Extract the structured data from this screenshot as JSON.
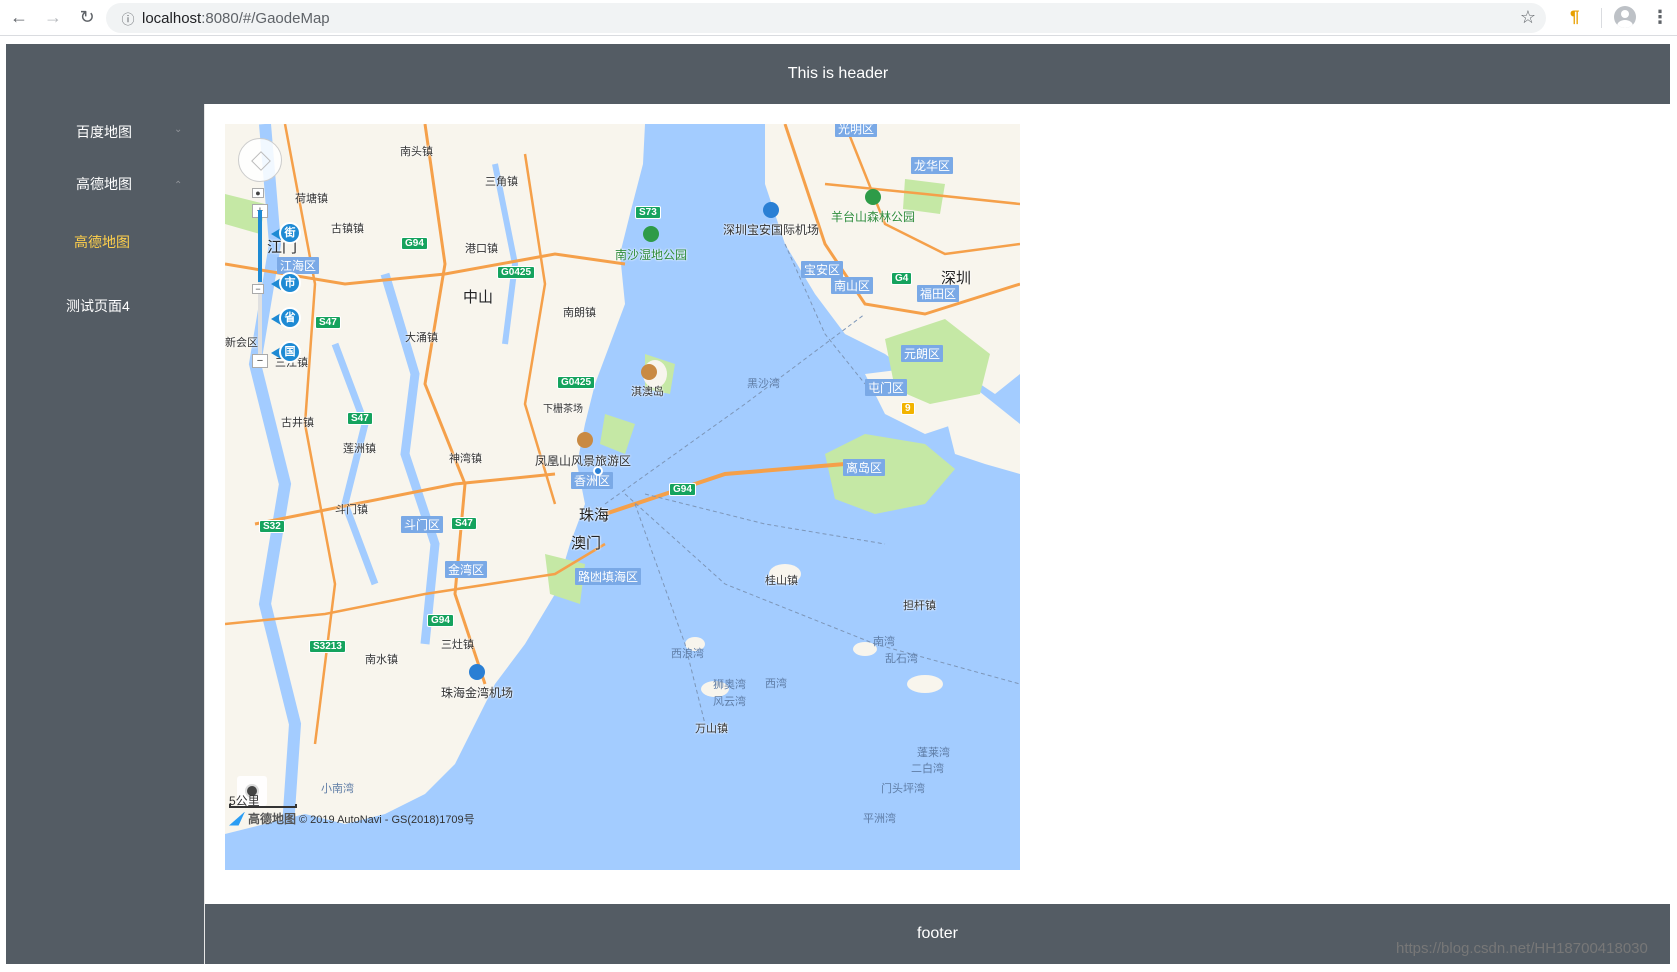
{
  "browser": {
    "back_icon": "arrow-left-icon",
    "forward_icon": "arrow-right-icon",
    "reload_icon": "reload-icon",
    "url_host": "localhost",
    "url_rest": ":8080/#/GaodeMap",
    "bookmark_icon": "star-icon"
  },
  "header": {
    "title": "This is header"
  },
  "sidebar": {
    "menu": [
      {
        "label": "百度地图",
        "expanded": false
      },
      {
        "label": "高德地图",
        "expanded": true
      },
      {
        "label": "测试页面4"
      }
    ],
    "submenu": [
      {
        "label": "高德地图",
        "active": true
      }
    ],
    "active_color": "#ffd04b",
    "bg_color": "#545c64"
  },
  "map": {
    "labels": {
      "zhongshan": "中山",
      "zhuhai": "珠海",
      "macau": "澳门",
      "shenzhen": "深圳",
      "jiangmen": "江门",
      "nanshaPark": "南沙湿地公园",
      "shenzhenAirport": "深圳宝安国际机场",
      "yangtaishan": "羊台山森林公园",
      "qiao": "淇澳岛",
      "fenghuangshan": "凤凰山风景旅游区",
      "zhuhaiAirport": "珠海金湾机场",
      "heisha": "黑沙湾",
      "nantou": "南头镇",
      "sanjiao": "三角镇",
      "gangkou": "港口镇",
      "nanlang": "南朗镇",
      "dayong": "大涌镇",
      "guzhen": "古镇镇",
      "heyuan": "荷塘镇",
      "gujing": "古井镇",
      "lianzhou": "莲洲镇",
      "shenwan": "神湾镇",
      "doumen_town": "斗门镇",
      "sanzao": "三灶镇",
      "nanshui": "南水镇",
      "guishan": "桂山镇",
      "danqian": "担杆镇",
      "xilang": "西浪湾",
      "shiaowan": "狮奥湾",
      "fengyun": "风云湾",
      "xiwan": "西湾",
      "wanshan": "万山镇",
      "nanwan": "南湾",
      "luanshi": "乱石湾",
      "xiaonan": "小南湾",
      "menutou": "门头坪湾",
      "pingzhou": "平洲湾",
      "erbai": "二白湾",
      "bianyi": "蓬莱湾",
      "xiazha": "下栅茶场",
      "sanjia": "三江镇",
      "xinhui": "新会区"
    },
    "districts": {
      "jianghai": "江海区",
      "xiangzhou": "香洲区",
      "doumen": "斗门区",
      "jinwan": "金湾区",
      "gaolan": "路凼填海区",
      "baoan": "宝安区",
      "nanshan": "南山区",
      "futian": "福田区",
      "longhua": "龙华区",
      "yuanlang": "元朗区",
      "tuenmun": "屯门区",
      "lidao": "离岛区",
      "guangming": "光明区"
    },
    "shields": [
      "G94",
      "G0425",
      "S73",
      "S47",
      "S47",
      "G0425",
      "G94",
      "S32",
      "S47",
      "G94",
      "S3213",
      "G4",
      "9"
    ],
    "zoom_markers": [
      "街",
      "市",
      "省",
      "国"
    ],
    "zoom_in_label": "+",
    "zoom_out_label": "−",
    "scale_label": "5公里",
    "brand": "高德地图",
    "copyright": "© 2019 AutoNavi - GS(2018)1709号",
    "locate_icon": "locate-icon",
    "pan_icon": "pan-control-icon",
    "water_color": "#a3ccff",
    "land_color": "#f8f5ed",
    "road_color": "#f5a04a",
    "park_color": "#c5e8a5"
  },
  "footer": {
    "title": "footer"
  },
  "watermark": "https://blog.csdn.net/HH18700418030"
}
